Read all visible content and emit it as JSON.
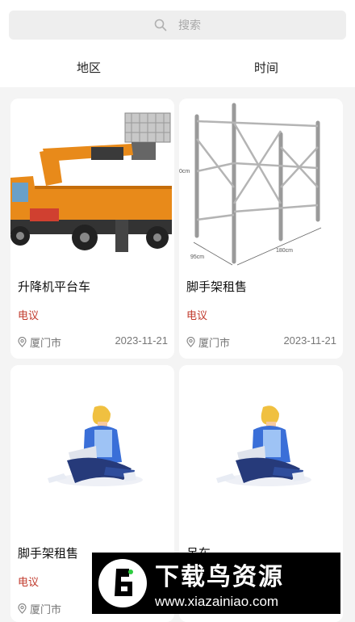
{
  "search": {
    "placeholder": "搜索"
  },
  "filters": [
    {
      "label": "地区"
    },
    {
      "label": "时间"
    }
  ],
  "listings": [
    {
      "title": "升降机平台车",
      "price": "电议",
      "location": "厦门市",
      "date": "2023-11-21",
      "image": "crane-truck-photo"
    },
    {
      "title": "脚手架租售",
      "price": "电议",
      "location": "厦门市",
      "date": "2023-11-21",
      "image": "scaffold-photo",
      "image_labels": [
        "95cm",
        "180cm",
        "0cm"
      ]
    },
    {
      "title": "脚手架租售",
      "price": "电议",
      "location": "厦门市",
      "date": "",
      "image": "person-laptop-illustration"
    },
    {
      "title": "吊车",
      "price": "",
      "location": "",
      "date": "",
      "image": "person-laptop-illustration"
    }
  ],
  "watermark": {
    "title": "下载鸟资源",
    "url": "www.xiazainiao.com"
  },
  "colors": {
    "price": "#c0392b",
    "background": "#f4f4f4",
    "card": "#ffffff"
  }
}
